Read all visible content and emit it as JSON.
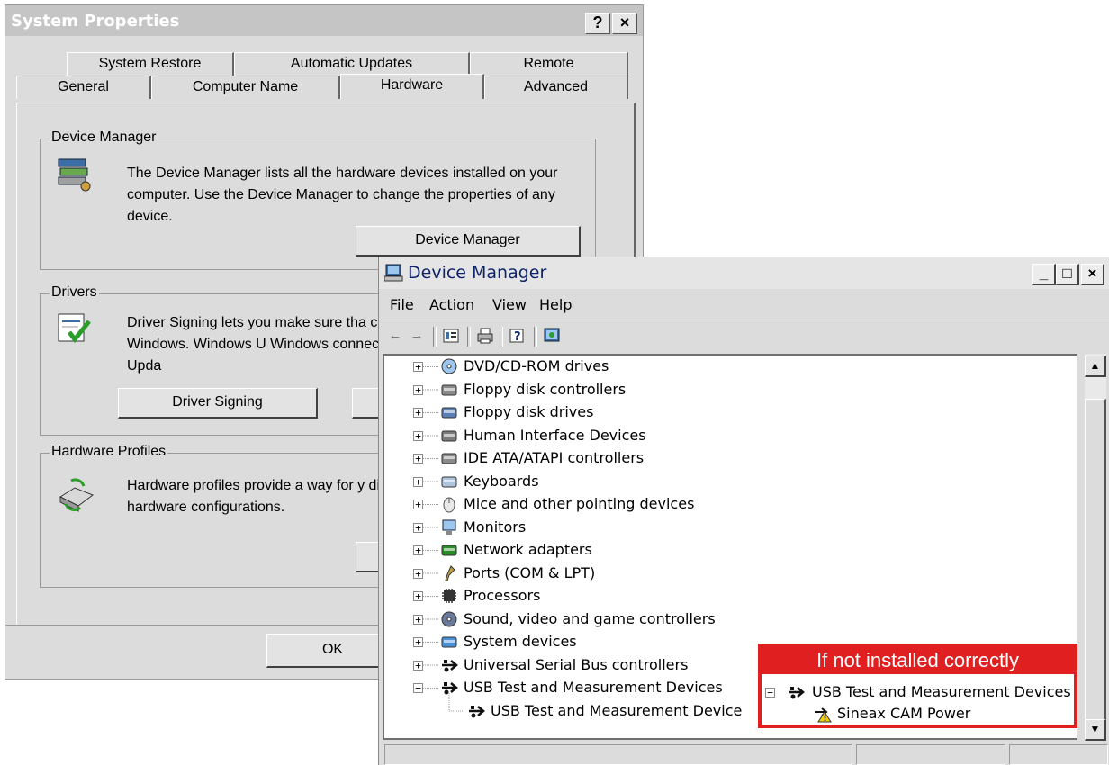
{
  "system_properties": {
    "title": "System Properties",
    "help_btn": "?",
    "close_btn": "×",
    "tabs_row1": [
      "System Restore",
      "Automatic Updates",
      "Remote"
    ],
    "tabs_row2": [
      "General",
      "Computer Name",
      "Hardware",
      "Advanced"
    ],
    "selected_tab": "Hardware",
    "device_manager_group": {
      "label": "Device Manager",
      "text": "The Device Manager lists all the hardware devices installed on your computer. Use the Device Manager to change the properties of any device.",
      "button": "Device Manager"
    },
    "drivers_group": {
      "label": "Drivers",
      "text": "Driver Signing lets you make sure tha compatible with Windows. Windows U Windows connects to Windows Upda",
      "button": "Driver Signing"
    },
    "hardware_profiles_group": {
      "label": "Hardware Profiles",
      "text": "Hardware profiles provide a way for y different hardware configurations."
    },
    "ok_button": "OK"
  },
  "device_manager": {
    "title": "Device Manager",
    "window_buttons": [
      "_",
      "□",
      "×"
    ],
    "menu": [
      "File",
      "Action",
      "View",
      "Help"
    ],
    "toolbar_icons": [
      "back-arrow-icon",
      "forward-arrow-icon",
      "properties-icon",
      "print-icon",
      "help-icon",
      "scan-hardware-icon"
    ],
    "tree": [
      {
        "label": "DVD/CD-ROM drives",
        "icon": "cdrom-icon",
        "expanded": false
      },
      {
        "label": "Floppy disk controllers",
        "icon": "disk-controller-icon",
        "expanded": false
      },
      {
        "label": "Floppy disk drives",
        "icon": "floppy-drive-icon",
        "expanded": false
      },
      {
        "label": "Human Interface Devices",
        "icon": "hid-icon",
        "expanded": false
      },
      {
        "label": "IDE ATA/ATAPI controllers",
        "icon": "ide-controller-icon",
        "expanded": false
      },
      {
        "label": "Keyboards",
        "icon": "keyboard-icon",
        "expanded": false
      },
      {
        "label": "Mice and other pointing devices",
        "icon": "mouse-icon",
        "expanded": false
      },
      {
        "label": "Monitors",
        "icon": "monitor-icon",
        "expanded": false
      },
      {
        "label": "Network adapters",
        "icon": "network-adapter-icon",
        "expanded": false
      },
      {
        "label": "Ports (COM & LPT)",
        "icon": "port-icon",
        "expanded": false
      },
      {
        "label": "Processors",
        "icon": "processor-icon",
        "expanded": false
      },
      {
        "label": "Sound, video and game controllers",
        "icon": "sound-icon",
        "expanded": false
      },
      {
        "label": "System devices",
        "icon": "system-device-icon",
        "expanded": false
      },
      {
        "label": "Universal Serial Bus controllers",
        "icon": "usb-icon",
        "expanded": false
      },
      {
        "label": "USB Test and Measurement Devices",
        "icon": "usb-icon",
        "expanded": true
      }
    ],
    "child": "USB Test and Measurement Device"
  },
  "callout": {
    "header": "If not installed correctly",
    "parent": "USB Test and Measurement Devices",
    "child": "Sineax CAM Power"
  },
  "colors": {
    "callout_red": "#e02020",
    "window_bg": "#dcdcdc",
    "title_text": "#10246a"
  }
}
